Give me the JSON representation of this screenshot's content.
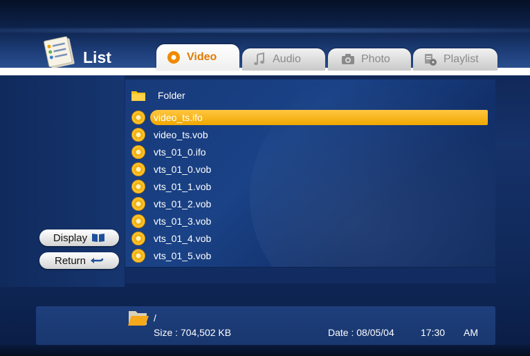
{
  "header": {
    "title": "List",
    "tabs": [
      {
        "label": "Video",
        "icon": "video-icon",
        "active": true
      },
      {
        "label": "Audio",
        "icon": "music-note-icon",
        "active": false
      },
      {
        "label": "Photo",
        "icon": "camera-icon",
        "active": false
      },
      {
        "label": "Playlist",
        "icon": "playlist-icon",
        "active": false
      }
    ]
  },
  "sidebar": {
    "display_label": "Display",
    "return_label": "Return"
  },
  "list": {
    "folder_label": "Folder",
    "items": [
      {
        "name": "video_ts.ifo",
        "selected": true
      },
      {
        "name": "video_ts.vob",
        "selected": false
      },
      {
        "name": "vts_01_0.ifo",
        "selected": false
      },
      {
        "name": "vts_01_0.vob",
        "selected": false
      },
      {
        "name": "vts_01_1.vob",
        "selected": false
      },
      {
        "name": "vts_01_2.vob",
        "selected": false
      },
      {
        "name": "vts_01_3.vob",
        "selected": false
      },
      {
        "name": "vts_01_4.vob",
        "selected": false
      },
      {
        "name": "vts_01_5.vob",
        "selected": false
      }
    ]
  },
  "info": {
    "path": "/",
    "size": "Size : 704,502 KB",
    "date": "Date : 08/05/04",
    "time": "17:30",
    "ampm": "AM"
  },
  "colors": {
    "accent": "#f0a800",
    "tab_active_text": "#e07a00",
    "background": "#16326a"
  }
}
